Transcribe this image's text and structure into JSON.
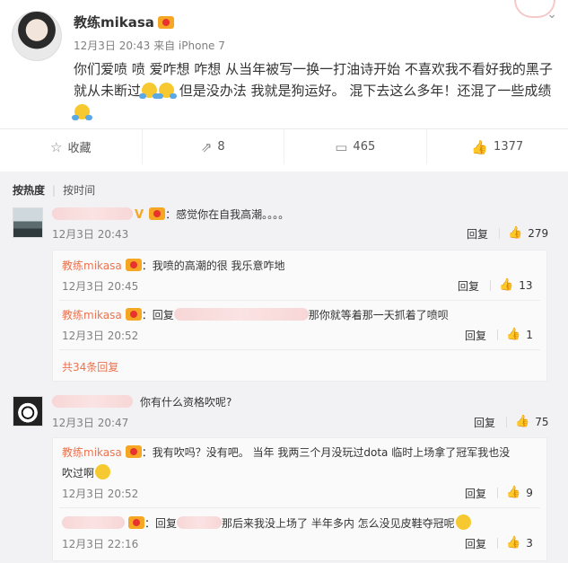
{
  "post": {
    "author": "教练mikasa",
    "meta": "12月3日 20:43 来自 iPhone 7",
    "text_before": "你们爱喷 喷  爱咋想 咋想 从当年被写一换一打油诗开始 不喜欢我不看好我的黑子就从未断过",
    "text_middle": " 但是没办法 我就是狗运好。 混下去这么多年！还混了一些成绩",
    "text_after": ""
  },
  "actions": {
    "favorite": "收藏",
    "repost_count": "8",
    "comment_count": "465",
    "like_count": "1377"
  },
  "sort": {
    "hot": "按热度",
    "time": "按时间"
  },
  "comments": [
    {
      "text": "：感觉你在自我高潮。。。。",
      "time": "12月3日 20:43",
      "reply": "回复",
      "likes": "279",
      "replies": [
        {
          "name": "教练mikasa",
          "text": "：我喷的高潮的很 我乐意咋地",
          "time": "12月3日 20:45",
          "reply": "回复",
          "likes": "13"
        },
        {
          "name": "教练mikasa",
          "text_prefix": "：回复",
          "text": "那你就等着那一天抓着了喷呗",
          "time": "12月3日 20:52",
          "reply": "回复",
          "likes": "1"
        }
      ],
      "more": "共34条回复"
    },
    {
      "text": "你有什么资格吹呢?",
      "time": "12月3日 20:47",
      "reply": "回复",
      "likes": "75",
      "replies": [
        {
          "name": "教练mikasa",
          "text_line1": "：我有吹吗？没有吧。 当年 我两三个月没玩过dota 临时上场拿了冠军我也没",
          "text_line2": "吹过啊",
          "time": "12月3日 20:52",
          "reply": "回复",
          "likes": "9"
        },
        {
          "text_prefix": "：回复",
          "text": "那后来我没上场了 半年多内 怎么没见皮鞋夺冠呢",
          "time": "12月3日 22:16",
          "reply": "回复",
          "likes": "3"
        }
      ]
    }
  ],
  "icons": {
    "favorite": "star-icon",
    "repost": "repost-icon",
    "comment": "comment-icon",
    "like": "thumbs-up-icon",
    "menu": "chevron-down-icon"
  },
  "colors": {
    "accent": "#eb7350",
    "vip": "#f5a623",
    "background": "#f2f2f5"
  }
}
